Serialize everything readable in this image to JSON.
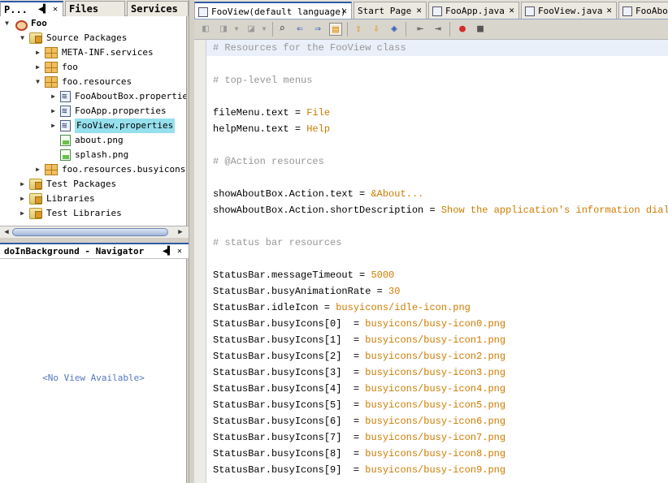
{
  "projects_tabs": [
    {
      "label": "P..."
    },
    {
      "label": "Files"
    },
    {
      "label": "Services"
    }
  ],
  "tree": [
    {
      "label": "Foo",
      "icon": "project-icon",
      "toggle": "▼",
      "bold": true
    },
    {
      "label": "Source Packages",
      "icon": "source-folder-icon",
      "toggle": "▼"
    },
    {
      "label": "META-INF.services",
      "icon": "package-icon",
      "toggle": "▶"
    },
    {
      "label": "foo",
      "icon": "package-icon",
      "toggle": "▶"
    },
    {
      "label": "foo.resources",
      "icon": "package-icon",
      "toggle": "▼"
    },
    {
      "label": "FooAboutBox.properties",
      "icon": "properties-file-icon",
      "toggle": "▶"
    },
    {
      "label": "FooApp.properties",
      "icon": "properties-file-icon",
      "toggle": "▶"
    },
    {
      "label": "FooView.properties",
      "icon": "properties-file-icon",
      "toggle": "▶",
      "selected": true
    },
    {
      "label": "about.png",
      "icon": "image-file-icon",
      "toggle": ""
    },
    {
      "label": "splash.png",
      "icon": "image-file-icon",
      "toggle": ""
    },
    {
      "label": "foo.resources.busyicons",
      "icon": "package-icon",
      "toggle": "▶"
    },
    {
      "label": "Test Packages",
      "icon": "test-folder-icon",
      "toggle": "▶"
    },
    {
      "label": "Libraries",
      "icon": "library-folder-icon",
      "toggle": "▶"
    },
    {
      "label": "Test Libraries",
      "icon": "test-library-folder-icon",
      "toggle": "▶"
    }
  ],
  "navigator": {
    "title": "doInBackground - Navigator",
    "empty_text": "<No View Available>"
  },
  "editor_tabs": [
    {
      "label": "FooView(default language)",
      "active": true
    },
    {
      "label": "Start Page"
    },
    {
      "label": "FooApp.java"
    },
    {
      "label": "FooView.java"
    },
    {
      "label": "FooAbo"
    }
  ],
  "code_lines": [
    {
      "comment": "# Resources for the FooView class"
    },
    {},
    {
      "comment": "# top-level menus"
    },
    {},
    {
      "key": "fileMenu.text",
      "sep": " = ",
      "value": "File"
    },
    {
      "key": "helpMenu.text",
      "sep": " = ",
      "value": "Help"
    },
    {},
    {
      "comment": "# @Action resources"
    },
    {},
    {
      "key": "showAboutBox.Action.text",
      "sep": " = ",
      "value": "&About..."
    },
    {
      "key": "showAboutBox.Action.shortDescription",
      "sep": " = ",
      "value": "Show the application's information dialog"
    },
    {},
    {
      "comment": "# status bar resources"
    },
    {},
    {
      "key": "StatusBar.messageTimeout",
      "sep": " = ",
      "value": "5000"
    },
    {
      "key": "StatusBar.busyAnimationRate",
      "sep": " = ",
      "value": "30"
    },
    {
      "key": "StatusBar.idleIcon",
      "sep": " = ",
      "value": "busyicons/idle-icon.png"
    },
    {
      "key": "StatusBar.busyIcons[0]",
      "sep": "  = ",
      "value": "busyicons/busy-icon0.png"
    },
    {
      "key": "StatusBar.busyIcons[1]",
      "sep": "  = ",
      "value": "busyicons/busy-icon1.png"
    },
    {
      "key": "StatusBar.busyIcons[2]",
      "sep": "  = ",
      "value": "busyicons/busy-icon2.png"
    },
    {
      "key": "StatusBar.busyIcons[3]",
      "sep": "  = ",
      "value": "busyicons/busy-icon3.png"
    },
    {
      "key": "StatusBar.busyIcons[4]",
      "sep": "  = ",
      "value": "busyicons/busy-icon4.png"
    },
    {
      "key": "StatusBar.busyIcons[5]",
      "sep": "  = ",
      "value": "busyicons/busy-icon5.png"
    },
    {
      "key": "StatusBar.busyIcons[6]",
      "sep": "  = ",
      "value": "busyicons/busy-icon6.png"
    },
    {
      "key": "StatusBar.busyIcons[7]",
      "sep": "  = ",
      "value": "busyicons/busy-icon7.png"
    },
    {
      "key": "StatusBar.busyIcons[8]",
      "sep": "  = ",
      "value": "busyicons/busy-icon8.png"
    },
    {
      "key": "StatusBar.busyIcons[9]",
      "sep": "  = ",
      "value": "busyicons/busy-icon9.png"
    }
  ],
  "colors": {
    "comment": "#969696",
    "value": "#ce7b00",
    "selection": "#96e0ee",
    "active_tab_border": "#2d5aa6"
  }
}
